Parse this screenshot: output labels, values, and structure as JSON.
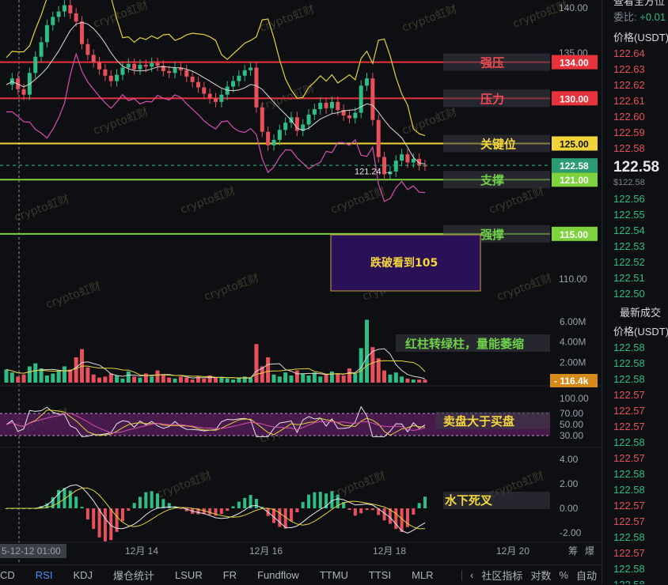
{
  "chart_data": {
    "type": "candlestick",
    "y_ticks": [
      "140.00",
      "135.00",
      "110.00"
    ],
    "x_ticks": [
      "12月 14",
      "12月 16",
      "12月 18",
      "12月 20"
    ],
    "crosshair_time": "5-12-12 01:00",
    "last_price": "122.58",
    "min_marker": "121.24",
    "levels": [
      {
        "price": "134.00",
        "label": "强压",
        "color": "#e8323c",
        "label_color": "#f04a52"
      },
      {
        "price": "130.00",
        "label": "压力",
        "color": "#e8323c",
        "label_color": "#f04a52"
      },
      {
        "price": "125.00",
        "label": "关键位",
        "color": "#f0d43a",
        "label_color": "#f5d63c"
      },
      {
        "price": "121.00",
        "label": "支撑",
        "color": "#7ed23c",
        "label_color": "#6fd04a"
      },
      {
        "price": "115.00",
        "label": "强撑",
        "color": "#7ed23c",
        "label_color": "#6fd04a"
      }
    ],
    "target_box_text": "跌破看到105",
    "price_series": [
      131.5,
      132.2,
      131.0,
      130.4,
      132.8,
      134.6,
      136.2,
      138.1,
      139.0,
      139.6,
      140.3,
      139.4,
      138.5,
      136.0,
      134.8,
      134.0,
      133.2,
      132.5,
      131.9,
      132.6,
      133.4,
      133.8,
      133.2,
      133.7,
      133.5,
      133.9,
      133.6,
      133.0,
      132.8,
      133.4,
      133.1,
      132.4,
      131.8,
      131.2,
      130.5,
      130.0,
      129.6,
      130.4,
      131.3,
      131.9,
      132.5,
      133.1,
      133.4,
      129.0,
      126.3,
      124.8,
      125.4,
      126.5,
      127.3,
      127.9,
      126.4,
      127.1,
      128.2,
      128.8,
      129.5,
      128.9,
      129.6,
      128.7,
      128.1,
      127.8,
      128.4,
      131.4,
      132.2,
      127.6,
      123.5,
      121.6,
      121.9,
      123.1,
      123.8,
      122.9,
      123.3,
      122.6,
      122.58
    ],
    "volume_axis": [
      "6.00M",
      "4.00M",
      "2.00M"
    ],
    "current_volume": "116.4k",
    "volume_series": [
      1.3,
      1.0,
      0.6,
      0.8,
      1.6,
      1.9,
      1.4,
      0.7,
      0.9,
      1.2,
      1.6,
      1.3,
      2.5,
      3.3,
      1.5,
      0.8,
      0.5,
      0.6,
      0.9,
      0.7,
      0.4,
      1.1,
      0.6,
      0.5,
      0.9,
      0.6,
      1.2,
      0.8,
      0.5,
      0.4,
      0.6,
      0.5,
      0.3,
      0.6,
      0.4,
      0.7,
      0.5,
      0.5,
      0.4,
      0.3,
      0.5,
      0.6,
      0.5,
      3.8,
      1.6,
      2.5,
      0.8,
      0.6,
      1.0,
      0.7,
      1.2,
      0.9,
      0.7,
      1.0,
      0.6,
      0.8,
      1.1,
      0.9,
      0.7,
      1.4,
      0.9,
      3.4,
      6.2,
      3.5,
      2.4,
      1.2,
      0.8,
      1.0,
      0.6,
      0.4,
      0.3,
      0.3,
      0.3
    ],
    "volume_note": "红柱转绿柱，量能萎缩",
    "rsi_axis": [
      "70.00",
      "50.00",
      "30.00"
    ],
    "rsi_note": "卖盘大于买盘",
    "macd_axis": [
      "4.00",
      "2.00",
      "0.00",
      "-2.00"
    ],
    "macd_note": "水下死叉"
  },
  "watermark": "crypto虹财",
  "toolbar": {
    "indicators": [
      "CD",
      "RSI",
      "KDJ",
      "爆仓统计",
      "LSUR",
      "FR",
      "Fundflow",
      "TTMU",
      "TTSI",
      "MLR"
    ],
    "active": "RSI",
    "right": [
      "社区指标",
      "对数",
      "%",
      "自动"
    ],
    "corner": [
      "筹",
      "爆"
    ]
  },
  "orderbook": {
    "title": "查看全方位",
    "ratio_label": "委比:",
    "ratio_value": "+0.01",
    "header_price": "价格(USDT)",
    "asks": [
      "122.64",
      "122.63",
      "122.62",
      "122.61",
      "122.60",
      "122.59",
      "122.58"
    ],
    "mid_price": "122.58",
    "mid_usd": "$122.58",
    "bids": [
      "122.56",
      "122.55",
      "122.54",
      "122.53",
      "122.52",
      "122.51",
      "122.50"
    ],
    "trades_title": "最新成交",
    "trades_header": "价格(USDT)",
    "trades": [
      {
        "p": "122.58",
        "side": "buy"
      },
      {
        "p": "122.58",
        "side": "buy"
      },
      {
        "p": "122.58",
        "side": "buy"
      },
      {
        "p": "122.57",
        "side": "sell"
      },
      {
        "p": "122.57",
        "side": "sell"
      },
      {
        "p": "122.57",
        "side": "sell"
      },
      {
        "p": "122.58",
        "side": "buy"
      },
      {
        "p": "122.57",
        "side": "sell"
      },
      {
        "p": "122.58",
        "side": "buy"
      },
      {
        "p": "122.58",
        "side": "buy"
      },
      {
        "p": "122.57",
        "side": "sell"
      },
      {
        "p": "122.57",
        "side": "sell"
      },
      {
        "p": "122.58",
        "side": "buy"
      },
      {
        "p": "122.57",
        "side": "sell"
      },
      {
        "p": "122.58",
        "side": "buy"
      },
      {
        "p": "122.58",
        "side": "buy"
      }
    ]
  }
}
